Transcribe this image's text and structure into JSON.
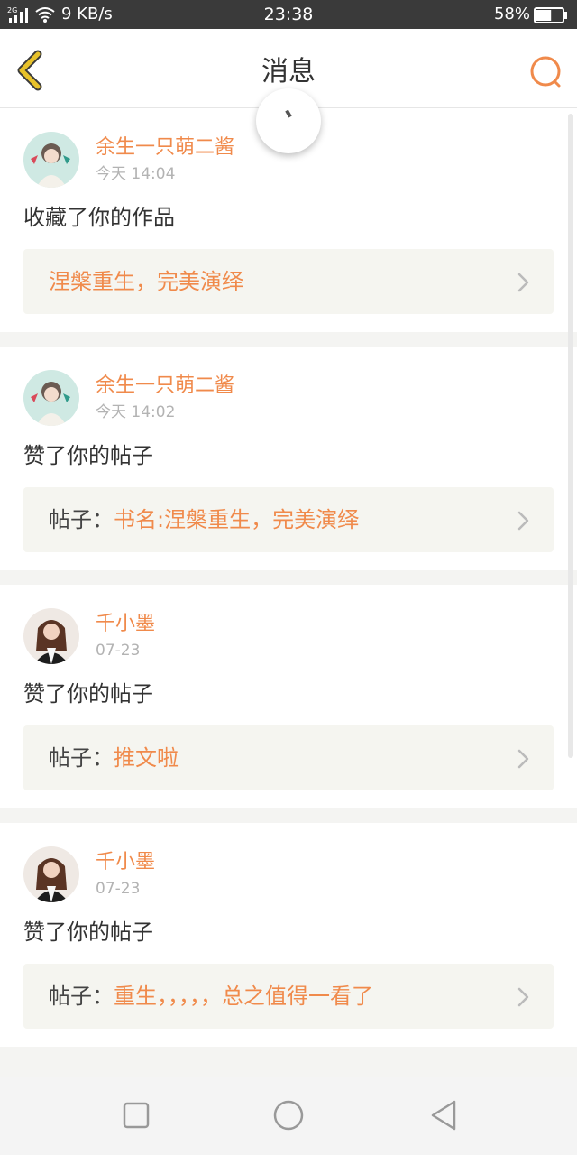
{
  "status_bar": {
    "network": "2G",
    "speed": "9 KB/s",
    "time": "23:38",
    "battery": "58%",
    "battery_level": 0.58
  },
  "header": {
    "title": "消息",
    "back_icon": "chevron-left-icon",
    "search_icon": "search-icon"
  },
  "colors": {
    "accent": "#f08a4b",
    "back_icon": "#e8c22a",
    "ref_bg": "#f5f5f0",
    "page_bg": "#f4f4f2"
  },
  "messages": [
    {
      "name": "余生一只萌二酱",
      "time": "今天 14:04",
      "action": "收藏了你的作品",
      "ref_prefix": "",
      "ref_link": "涅槃重生，完美演绎"
    },
    {
      "name": "余生一只萌二酱",
      "time": "今天 14:02",
      "action": "赞了你的帖子",
      "ref_prefix": "帖子：",
      "ref_link": "书名:涅槃重生，完美演绎"
    },
    {
      "name": "千小墨",
      "time": "07-23",
      "action": "赞了你的帖子",
      "ref_prefix": "帖子：",
      "ref_link": "推文啦"
    },
    {
      "name": "千小墨",
      "time": "07-23",
      "action": "赞了你的帖子",
      "ref_prefix": "帖子：",
      "ref_link": "重生，，，，，总之值得一看了"
    }
  ],
  "nav": {
    "recent_icon": "square-icon",
    "home_icon": "circle-icon",
    "back_icon": "triangle-back-icon"
  }
}
